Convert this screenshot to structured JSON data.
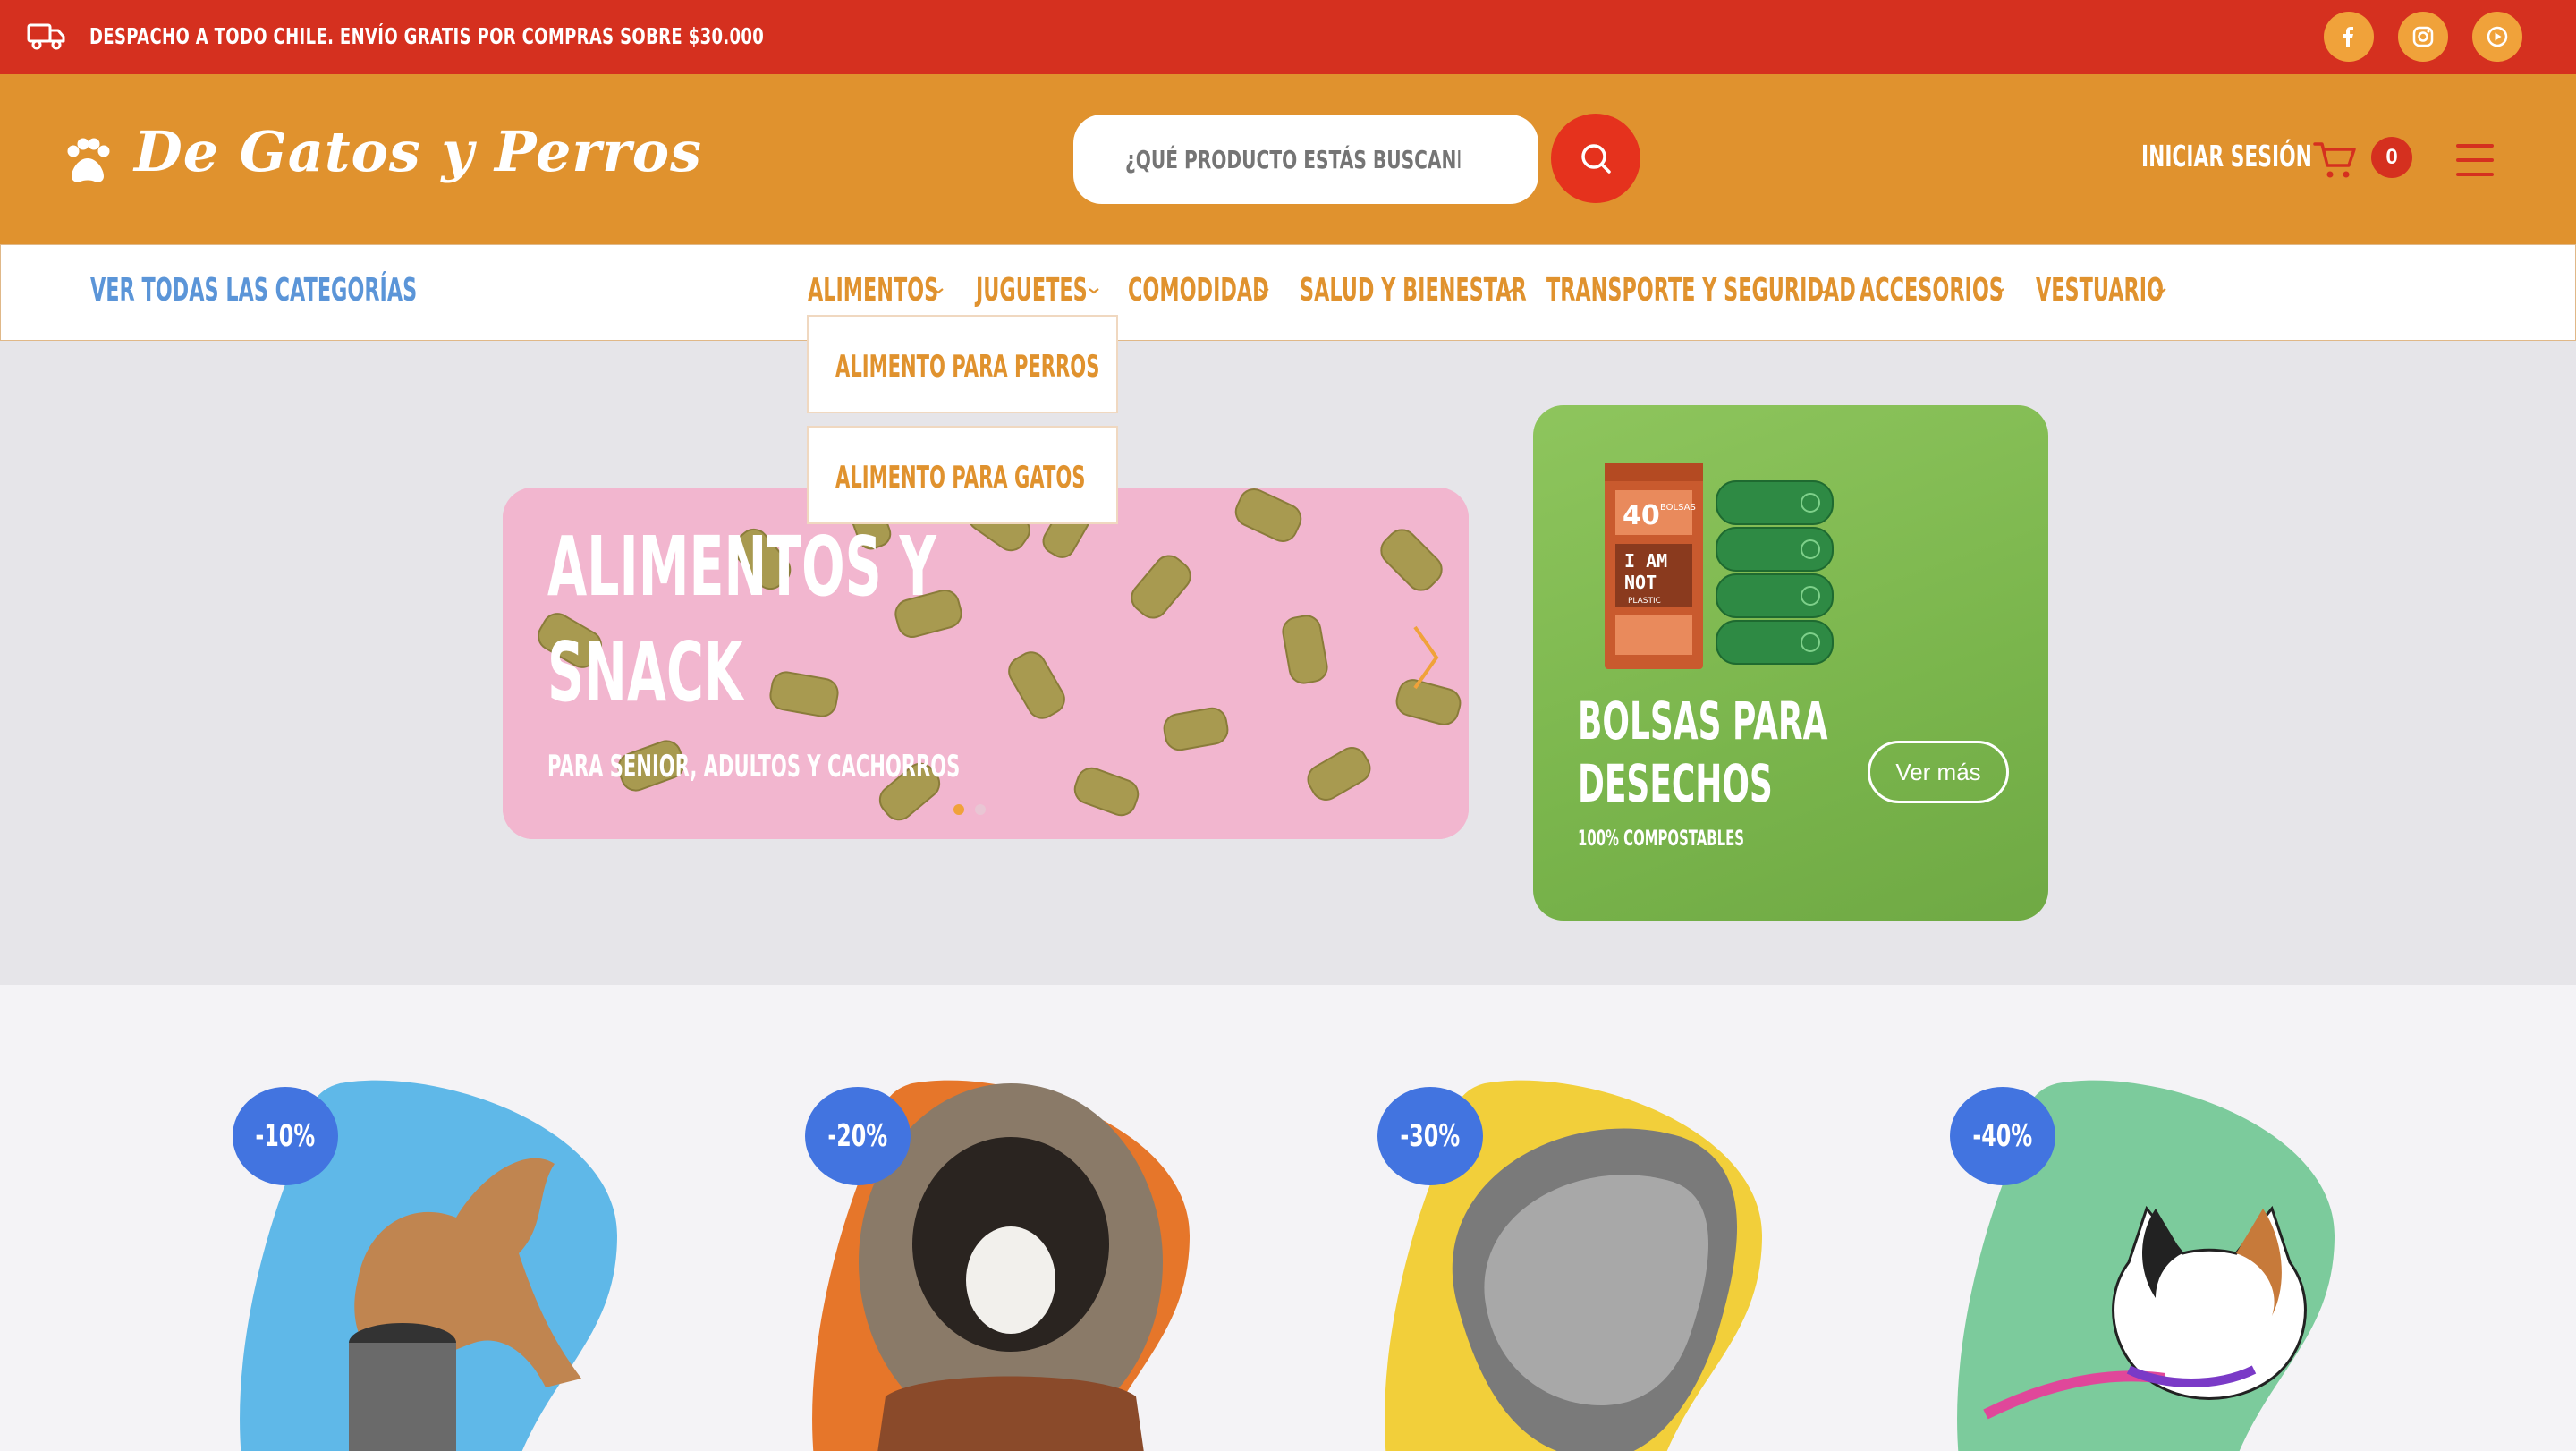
{
  "topbar": {
    "announcement": "DESPACHO A TODO CHILE. ENVÍO GRATIS POR COMPRAS SOBRE $30.000",
    "icons": [
      "truck-icon",
      "facebook-icon",
      "instagram-icon",
      "youtube-icon"
    ]
  },
  "header": {
    "logo": "De Gatos y Perros",
    "search_placeholder": "¿QUÉ PRODUCTO ESTÁS BUSCANDO?",
    "login": "INICIAR SESIÓN",
    "cart_count": "0"
  },
  "nav": {
    "all_categories": "VER TODAS LAS CATEGORÍAS",
    "items": [
      "ALIMENTOS",
      "JUGUETES",
      "COMODIDAD",
      "SALUD Y BIENESTAR",
      "TRANSPORTE Y SEGURIDAD",
      "ACCESORIOS",
      "VESTUARIO"
    ],
    "dropdown": [
      "ALIMENTO PARA PERROS",
      "ALIMENTO PARA GATOS"
    ]
  },
  "hero": {
    "slide": {
      "title_line1": "ALIMENTOS Y",
      "title_line2": "SNACK",
      "subtitle": "PARA SENIOR, ADULTOS Y CACHORROS"
    },
    "promo": {
      "title_line1": "BOLSAS PARA",
      "title_line2": "DESECHOS",
      "subtitle": "100% COMPOSTABLES",
      "button": "Ver más",
      "package_text": [
        "40",
        "BOLSAS",
        "I AM",
        "NOT",
        "PLASTIC"
      ]
    }
  },
  "products": [
    {
      "discount": "-10%",
      "color": "#5fb8e8"
    },
    {
      "discount": "-20%",
      "color": "#e6762a"
    },
    {
      "discount": "-30%",
      "color": "#f2cf3a"
    },
    {
      "discount": "-40%",
      "color": "#7ccb9c"
    }
  ],
  "colors": {
    "red": "#d5301f",
    "orange": "#e0922e",
    "blue": "#5b95d8",
    "badge": "#4274e0"
  }
}
